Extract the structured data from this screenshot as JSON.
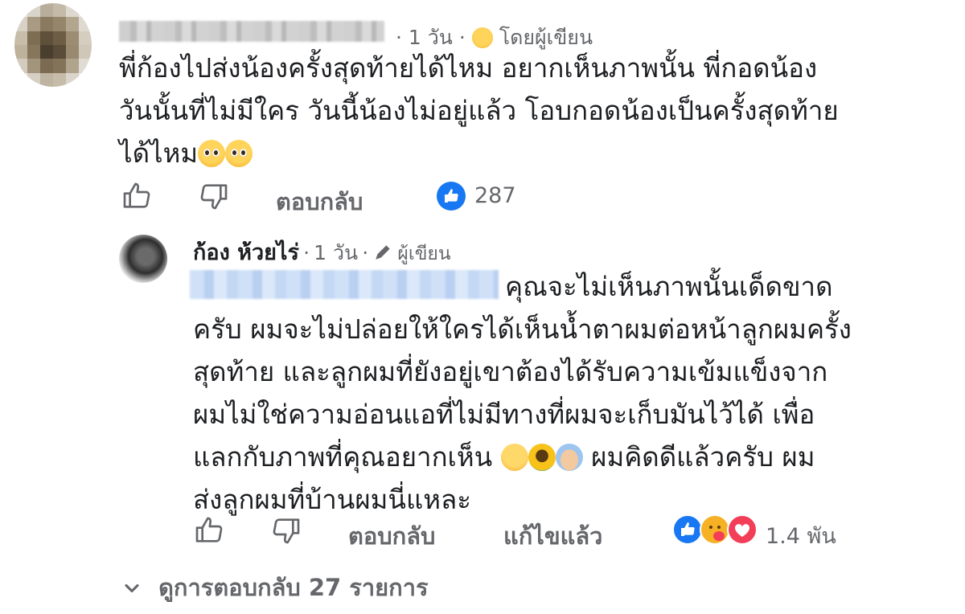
{
  "comment": {
    "time": "1 วัน",
    "separator": "·",
    "author_badge": "โดยผู้เขียน",
    "text_line1": "พี่ก้องไปส่งน้องครั้งสุดท้ายได้ไหม อยากเห็นภาพนั้น พี่กอดน้อง",
    "text_line2": "วันนั้นที่ไม่มีใคร วันนี้น้องไม่อยู่แล้ว โอบกอดน้องเป็นครั้งสุดท้าย",
    "text_line3": "ได้ไหม",
    "reply_label": "ตอบกลับ",
    "like_count": "287",
    "icons": [
      "thumbs-up-outline-icon",
      "thumbs-down-outline-icon",
      "like-reaction-icon",
      "hug-emoji-icon",
      "pleading-face-emoji"
    ]
  },
  "reply": {
    "author_name": "ก้อง ห้วยไร่",
    "time": "1 วัน",
    "separator": "·",
    "author_badge": "ผู้เขียน",
    "text_line1": "คุณจะไม่เห็นภาพนั้นเด็ดขาด",
    "text_line2": "ครับ ผมจะไม่ปล่อยให้ใครได้เห็นน้ำตาผมต่อหน้าลูกผมครั้ง",
    "text_line3": "สุดท้าย และลูกผมที่ยังอยู่เขาต้องได้รับความเข้มแข็งจาก",
    "text_line4": "ผมไม่ใช่ความอ่อนแอที่ไม่มีทางที่ผมจะเก็บมันไว้ได้ เพื่อ",
    "text_line5a": "แลกกับภาพที่คุณอยากเห็น",
    "text_line5b": "ผมคิดดีแล้วครับ ผม",
    "text_line6": "ส่งลูกผมที่บ้านผมนี่แหละ",
    "reply_label": "ตอบกลับ",
    "edited_label": "แก้ไขแล้ว",
    "reaction_count": "1.4 พัน",
    "icons": [
      "pen-icon",
      "smiling-face-emoji",
      "sunflower-emoji",
      "folded-hands-emoji",
      "like-reaction-icon",
      "hug-reaction-icon",
      "heart-reaction-icon"
    ]
  },
  "view_replies": {
    "label": "ดูการตอบกลับ 27 รายการ"
  },
  "colors": {
    "text": "#1c1e21",
    "meta": "#65676b",
    "like_blue": "#1877f2",
    "heart_red": "#f33e58"
  }
}
